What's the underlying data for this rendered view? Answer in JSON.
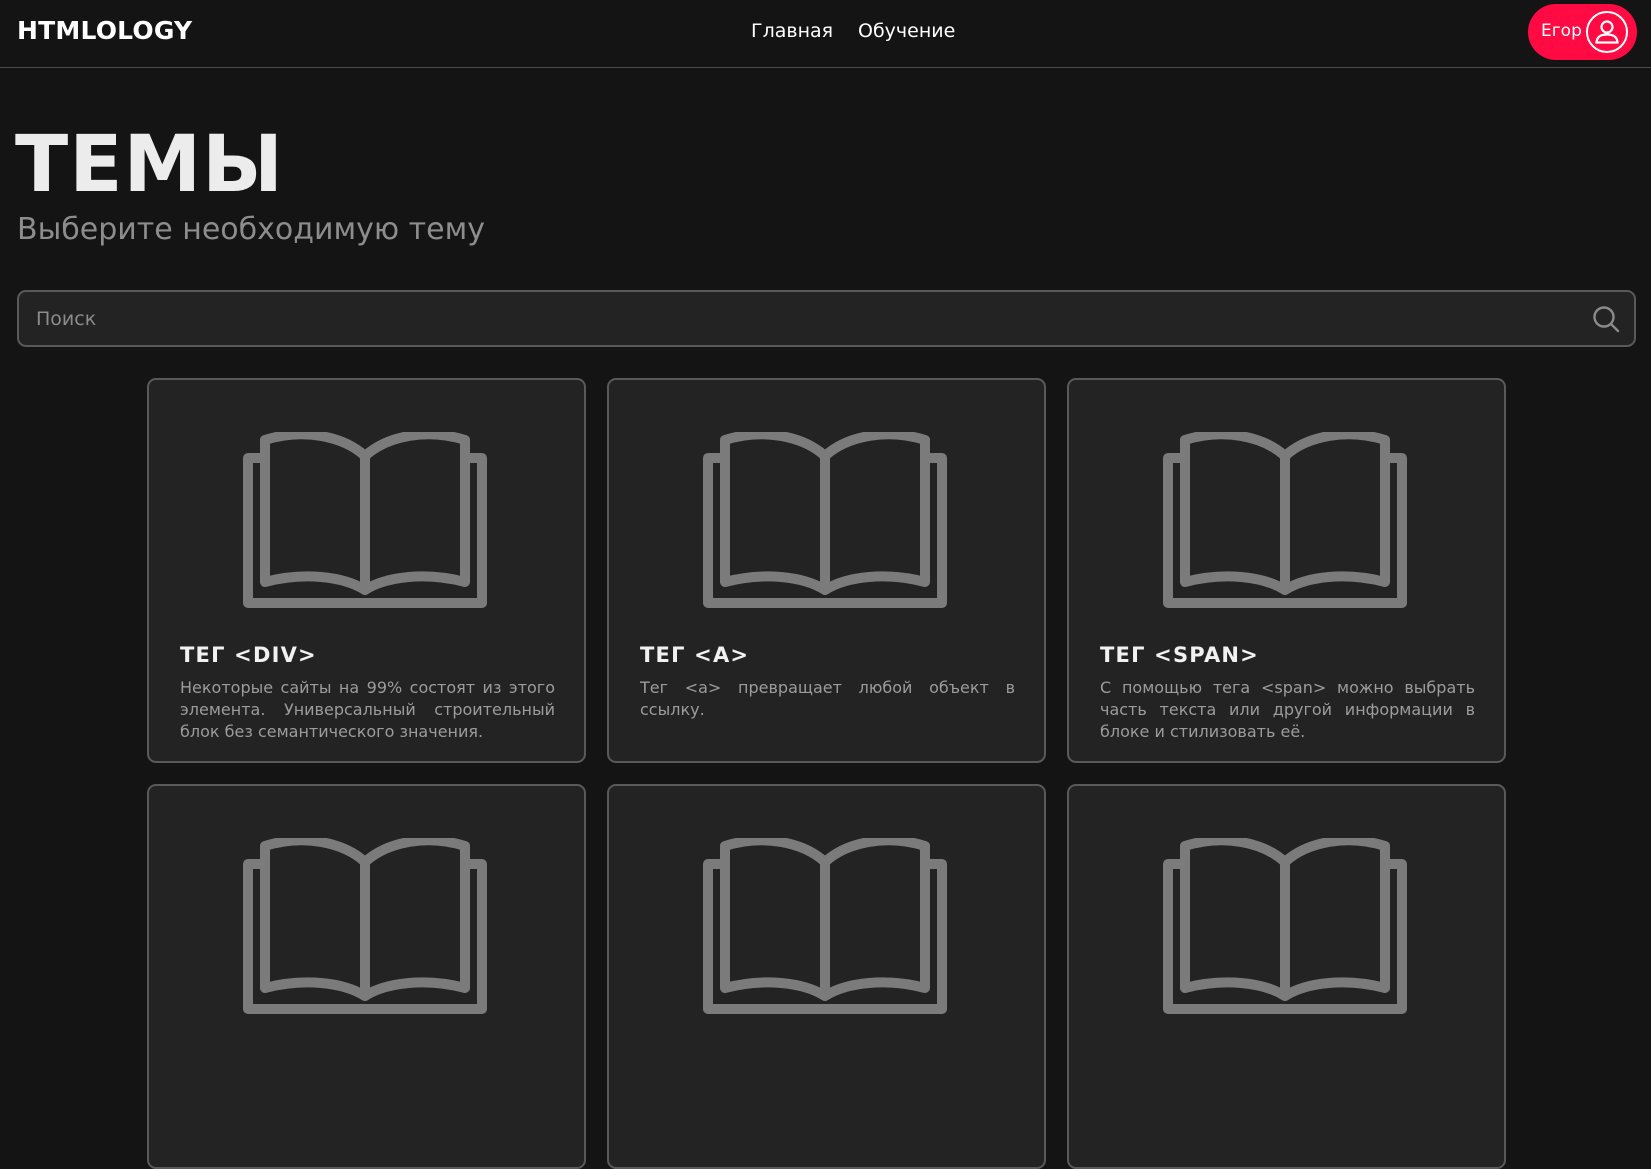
{
  "header": {
    "logo": "HTMLOLOGY",
    "nav": [
      {
        "label": "Главная"
      },
      {
        "label": "Обучение"
      }
    ],
    "user": {
      "name": "Егор",
      "icon": "user-icon"
    }
  },
  "main": {
    "title": "ТЕМЫ",
    "subtitle": "Выберите необходимую тему",
    "search": {
      "placeholder": "Поиск",
      "value": "",
      "icon": "search-icon"
    },
    "cards": [
      {
        "title": "ТЕГ <DIV>",
        "description": "Некоторые сайты на 99% состоят из этого элемента. Универсальный строительный блок без семантического значения.",
        "icon": "book-icon"
      },
      {
        "title": "ТЕГ <A>",
        "description": "Тег <a> превращает любой объект в ссылку.",
        "icon": "book-icon"
      },
      {
        "title": "ТЕГ <SPAN>",
        "description": "С помощью тега <span> можно выбрать часть текста или другой информации в блоке и стилизовать её.",
        "icon": "book-icon"
      },
      {
        "title": "",
        "description": "",
        "icon": "book-icon"
      },
      {
        "title": "",
        "description": "",
        "icon": "book-icon"
      },
      {
        "title": "",
        "description": "",
        "icon": "book-icon"
      }
    ]
  },
  "colors": {
    "background": "#141414",
    "card_background": "#232323",
    "card_border": "#595959",
    "accent": "#ff0a43",
    "icon": "#7b7b7b"
  }
}
